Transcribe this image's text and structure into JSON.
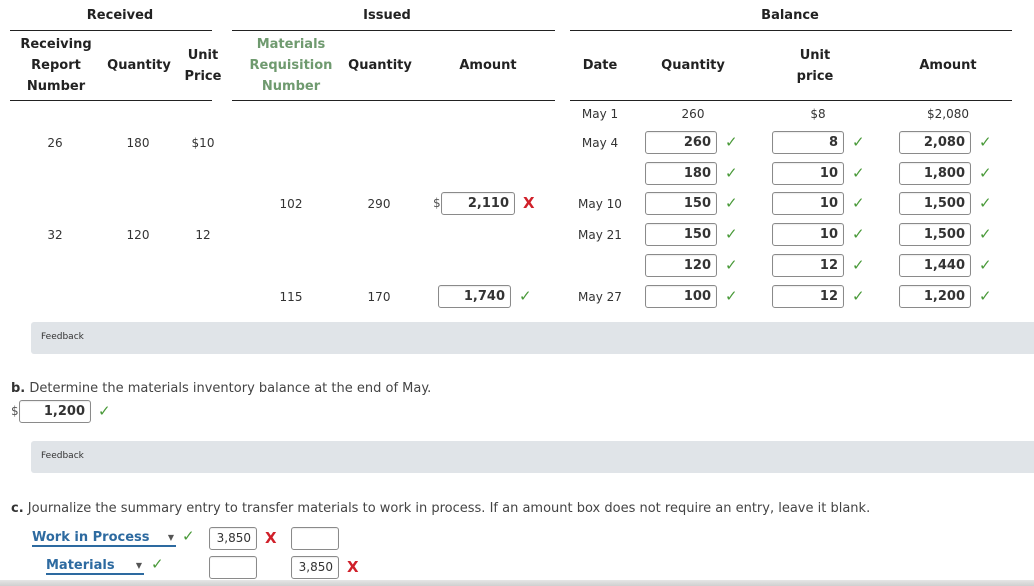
{
  "table": {
    "groups": {
      "received": "Received",
      "issued": "Issued",
      "balance": "Balance"
    },
    "headers": {
      "receiving_report_number": [
        "Receiving",
        "Report",
        "Number"
      ],
      "received_quantity": "Quantity",
      "received_unit_price": [
        "Unit",
        "Price"
      ],
      "materials_requisition_number": [
        "Materials",
        "Requisition",
        "Number"
      ],
      "issued_quantity": "Quantity",
      "issued_amount": "Amount",
      "date": "Date",
      "balance_quantity": "Quantity",
      "balance_unit_price": [
        "Unit",
        "price"
      ],
      "balance_amount": "Amount"
    },
    "received_rows": [
      {
        "report_number": "26",
        "quantity": "180",
        "unit_price": "$10"
      },
      {
        "report_number": "32",
        "quantity": "120",
        "unit_price": "12"
      }
    ],
    "issued_rows": [
      {
        "requisition_number": "102",
        "quantity": "290",
        "currency": "$",
        "amount": "2,110",
        "status": "incorrect"
      },
      {
        "requisition_number": "115",
        "quantity": "170",
        "currency": "",
        "amount": "1,740",
        "status": "correct"
      }
    ],
    "balance_rows": [
      {
        "date": "May 1",
        "quantity": "260",
        "unit_price": "$8",
        "amount": "$2,080",
        "editable": false
      },
      {
        "date": "May 4",
        "quantity": "260",
        "unit_price": "8",
        "amount": "2,080",
        "editable": true,
        "status": "correct"
      },
      {
        "date": "",
        "quantity": "180",
        "unit_price": "10",
        "amount": "1,800",
        "editable": true,
        "status": "correct"
      },
      {
        "date": "May 10",
        "quantity": "150",
        "unit_price": "10",
        "amount": "1,500",
        "editable": true,
        "status": "correct"
      },
      {
        "date": "May 21",
        "quantity": "150",
        "unit_price": "10",
        "amount": "1,500",
        "editable": true,
        "status": "correct"
      },
      {
        "date": "",
        "quantity": "120",
        "unit_price": "12",
        "amount": "1,440",
        "editable": true,
        "status": "correct"
      },
      {
        "date": "May 27",
        "quantity": "100",
        "unit_price": "12",
        "amount": "1,200",
        "editable": true,
        "status": "correct"
      }
    ]
  },
  "feedback_label": "Feedback",
  "part_b": {
    "letter": "b.",
    "prompt": "Determine the materials inventory balance at the end of May.",
    "currency": "$",
    "answer": "1,200",
    "status": "correct"
  },
  "part_c": {
    "letter": "c.",
    "prompt": "Journalize the summary entry to transfer materials to work in process. If an amount box does not require an entry, leave it blank.",
    "entries": [
      {
        "account": "Work in Process",
        "account_status": "correct",
        "debit": "3,850",
        "debit_status": "incorrect",
        "credit": "",
        "credit_status": ""
      },
      {
        "account": "Materials",
        "account_status": "correct",
        "debit": "",
        "debit_status": "",
        "credit": "3,850",
        "credit_status": "incorrect"
      }
    ]
  },
  "icons": {
    "correct": "✓",
    "incorrect": "X",
    "dropdown": "▼"
  },
  "colors": {
    "correct": "#4a9a3a",
    "incorrect": "#d0202a",
    "link": "#2d6aa0",
    "feedback_bg": "#e0e4e8",
    "header_green": "#6f9a6f"
  }
}
